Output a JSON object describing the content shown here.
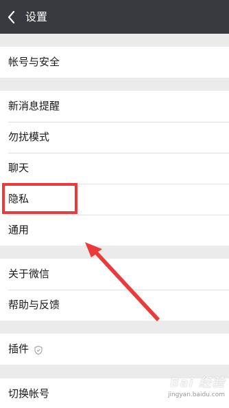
{
  "header": {
    "title": "设置",
    "back_icon": "chevron-left-icon"
  },
  "groups": [
    {
      "items": [
        {
          "label": "帐号与安全"
        }
      ]
    },
    {
      "items": [
        {
          "label": "新消息提醒"
        },
        {
          "label": "勿扰模式"
        },
        {
          "label": "聊天"
        },
        {
          "label": "隐私"
        },
        {
          "label": "通用"
        }
      ]
    },
    {
      "items": [
        {
          "label": "关于微信"
        },
        {
          "label": "帮助与反馈"
        }
      ]
    },
    {
      "items": [
        {
          "label": "插件",
          "icon": "shield-icon"
        }
      ]
    },
    {
      "items": [
        {
          "label": "切换帐号"
        }
      ]
    }
  ],
  "annotation": {
    "highlight_target": "隐私",
    "color": "#ec3a3b"
  },
  "watermark": {
    "main": "Bai 经验",
    "sub": "jingyan.baidu.com"
  },
  "colors": {
    "header_bg": "#393a3f",
    "page_bg": "#ebebeb",
    "row_bg": "#ffffff",
    "annotation": "#ec3a3b"
  }
}
